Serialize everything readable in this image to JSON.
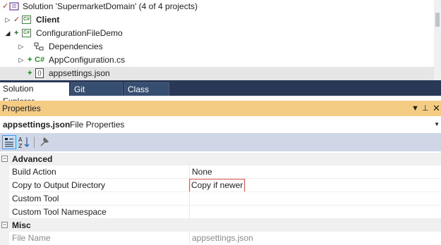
{
  "tree": {
    "solution_label": "Solution 'SupermarketDomain' (4 of 4 projects)",
    "client_label": "Client",
    "configfile_demo_label": "ConfigurationFileDemo",
    "dependencies_label": "Dependencies",
    "appconfig_label": "AppConfiguration.cs",
    "appsettings_label": "appsettings.json",
    "csproj_badge": "C#",
    "csfile_badge": "C#",
    "json_badge": "{}"
  },
  "tabs": [
    {
      "label": "Solution Explorer"
    },
    {
      "label": "Git Changes"
    },
    {
      "label": "Class View"
    }
  ],
  "properties": {
    "title": "Properties",
    "object_name": "appsettings.json",
    "object_kind": "File Properties",
    "categories": [
      {
        "name": "Advanced",
        "rows": [
          {
            "name": "Build Action",
            "value": "None"
          },
          {
            "name": "Copy to Output Directory",
            "value": "Copy if newer"
          },
          {
            "name": "Custom Tool",
            "value": ""
          },
          {
            "name": "Custom Tool Namespace",
            "value": ""
          }
        ]
      },
      {
        "name": "Misc",
        "rows": [
          {
            "name": "File Name",
            "value": "appsettings.json"
          }
        ]
      }
    ]
  },
  "colors": {
    "tab_bar": "#293955",
    "properties_title": "#f5cc84",
    "toolbar": "#cfd6e5",
    "highlight_box": "#e05757",
    "check_red": "#c42b1c",
    "add_green": "#107c10"
  }
}
